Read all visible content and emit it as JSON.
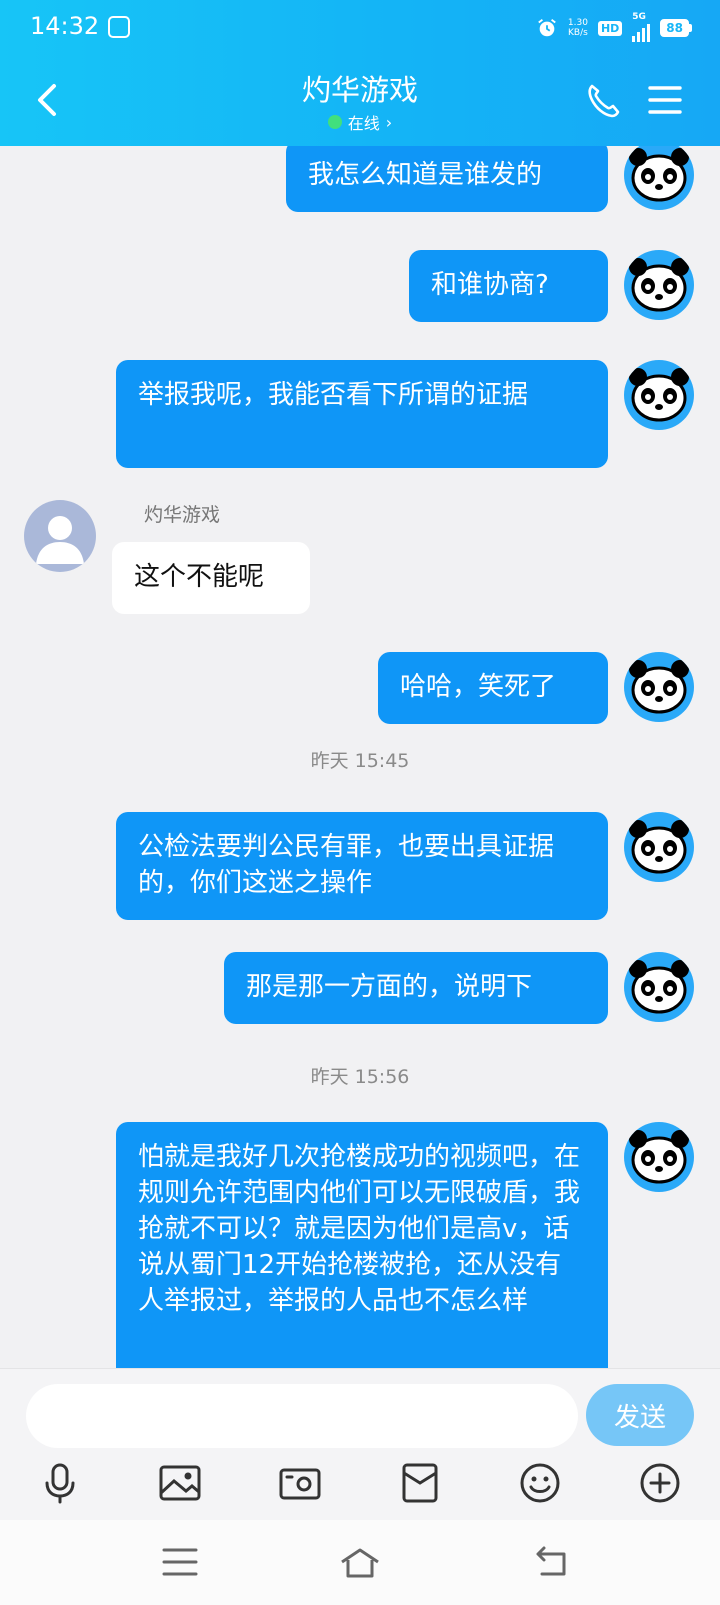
{
  "status_bar": {
    "time": "14:32",
    "net_speed": "1.30",
    "net_unit": "KB/s",
    "hd": "HD",
    "network": "5G",
    "battery": "88"
  },
  "header": {
    "title": "灼华游戏",
    "status": "在线",
    "status_color": "#41e07d",
    "accent": "#14b4f6"
  },
  "messages": [
    {
      "text": "我怎么知道是谁发的"
    },
    {
      "text": "和谁协商?"
    },
    {
      "text": "举报我呢，我能否看下所谓的证据"
    },
    {
      "sender": "灼华游戏",
      "text": "这个不能呢"
    },
    {
      "text": "哈哈，笑死了"
    },
    {
      "time": "昨天  15:45"
    },
    {
      "text": "公检法要判公民有罪，也要出具证据的，你们这迷之操作"
    },
    {
      "text": "那是那一方面的，说明下"
    },
    {
      "time": "昨天  15:56"
    },
    {
      "text": "怕就是我好几次抢楼成功的视频吧，在规则允许范围内他们可以无限破盾，我抢就不可以？就是因为他们是高v，话说从蜀门12开始抢楼被抢，还从没有人举报过，举报的人品也不怎么样"
    }
  ],
  "input": {
    "placeholder": "",
    "send_label": "发送"
  },
  "toolbar": {
    "icons": [
      "microphone-icon",
      "image-icon",
      "camera-icon",
      "red-packet-icon",
      "emoji-icon",
      "plus-icon"
    ]
  },
  "nav": {
    "icons": [
      "menu-icon",
      "home-icon",
      "back-icon"
    ]
  }
}
